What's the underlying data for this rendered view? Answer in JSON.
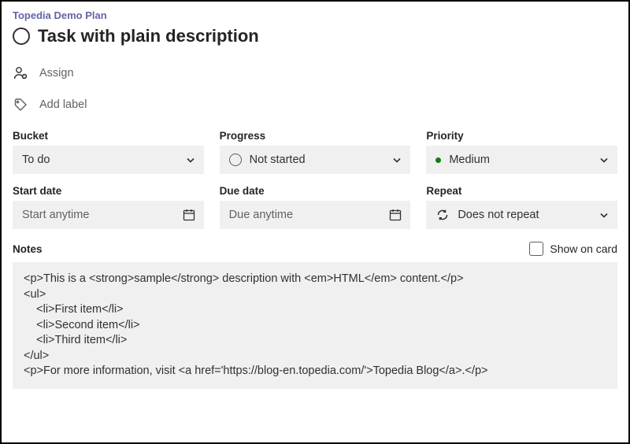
{
  "plan": {
    "name": "Topedia Demo Plan"
  },
  "task": {
    "title": "Task with plain description",
    "assign_label": "Assign",
    "label_label": "Add label"
  },
  "fields": {
    "bucket": {
      "label": "Bucket",
      "value": "To do"
    },
    "progress": {
      "label": "Progress",
      "value": "Not started"
    },
    "priority": {
      "label": "Priority",
      "value": "Medium"
    },
    "start": {
      "label": "Start date",
      "placeholder": "Start anytime"
    },
    "due": {
      "label": "Due date",
      "placeholder": "Due anytime"
    },
    "repeat": {
      "label": "Repeat",
      "value": "Does not repeat"
    }
  },
  "notes": {
    "label": "Notes",
    "show_on_card_label": "Show on card",
    "content": "<p>This is a <strong>sample</strong> description with <em>HTML</em> content.</p>\n<ul>\n    <li>First item</li>\n    <li>Second item</li>\n    <li>Third item</li>\n</ul>\n<p>For more information, visit <a href='https://blog-en.topedia.com/'>Topedia Blog</a>.</p>"
  }
}
